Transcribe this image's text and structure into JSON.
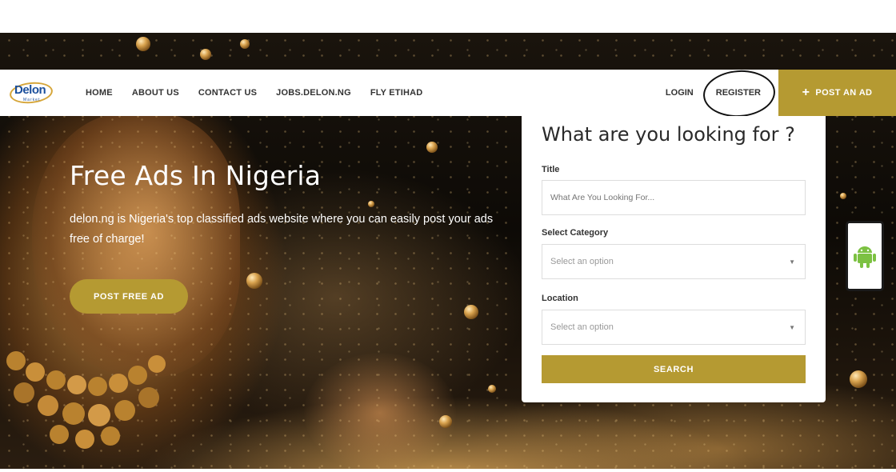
{
  "brand": {
    "logo_text": "Delon",
    "logo_sub": "Market"
  },
  "nav": {
    "items": [
      {
        "label": "HOME"
      },
      {
        "label": "ABOUT US"
      },
      {
        "label": "CONTACT US"
      },
      {
        "label": "JOBS.DELON.NG"
      },
      {
        "label": "FLY ETIHAD"
      }
    ],
    "login": "LOGIN",
    "register": "REGISTER",
    "post_ad": "POST AN AD"
  },
  "hero": {
    "title": "Free Ads In Nigeria",
    "description": "delon.ng is Nigeria's top classified ads website where you can easily post your ads free of charge!",
    "cta": "POST FREE AD"
  },
  "search_panel": {
    "heading": "What are you looking for ?",
    "title_label": "Title",
    "title_placeholder": "What Are You Looking For...",
    "category_label": "Select Category",
    "category_value": "Select an option",
    "location_label": "Location",
    "location_value": "Select an option",
    "search_button": "SEARCH"
  },
  "colors": {
    "accent": "#b59a32",
    "logo_blue": "#1b4f9c",
    "android_green": "#7cc142"
  },
  "icons": {
    "plus": "plus-icon",
    "android": "android-icon",
    "caret": "chevron-down-icon"
  }
}
